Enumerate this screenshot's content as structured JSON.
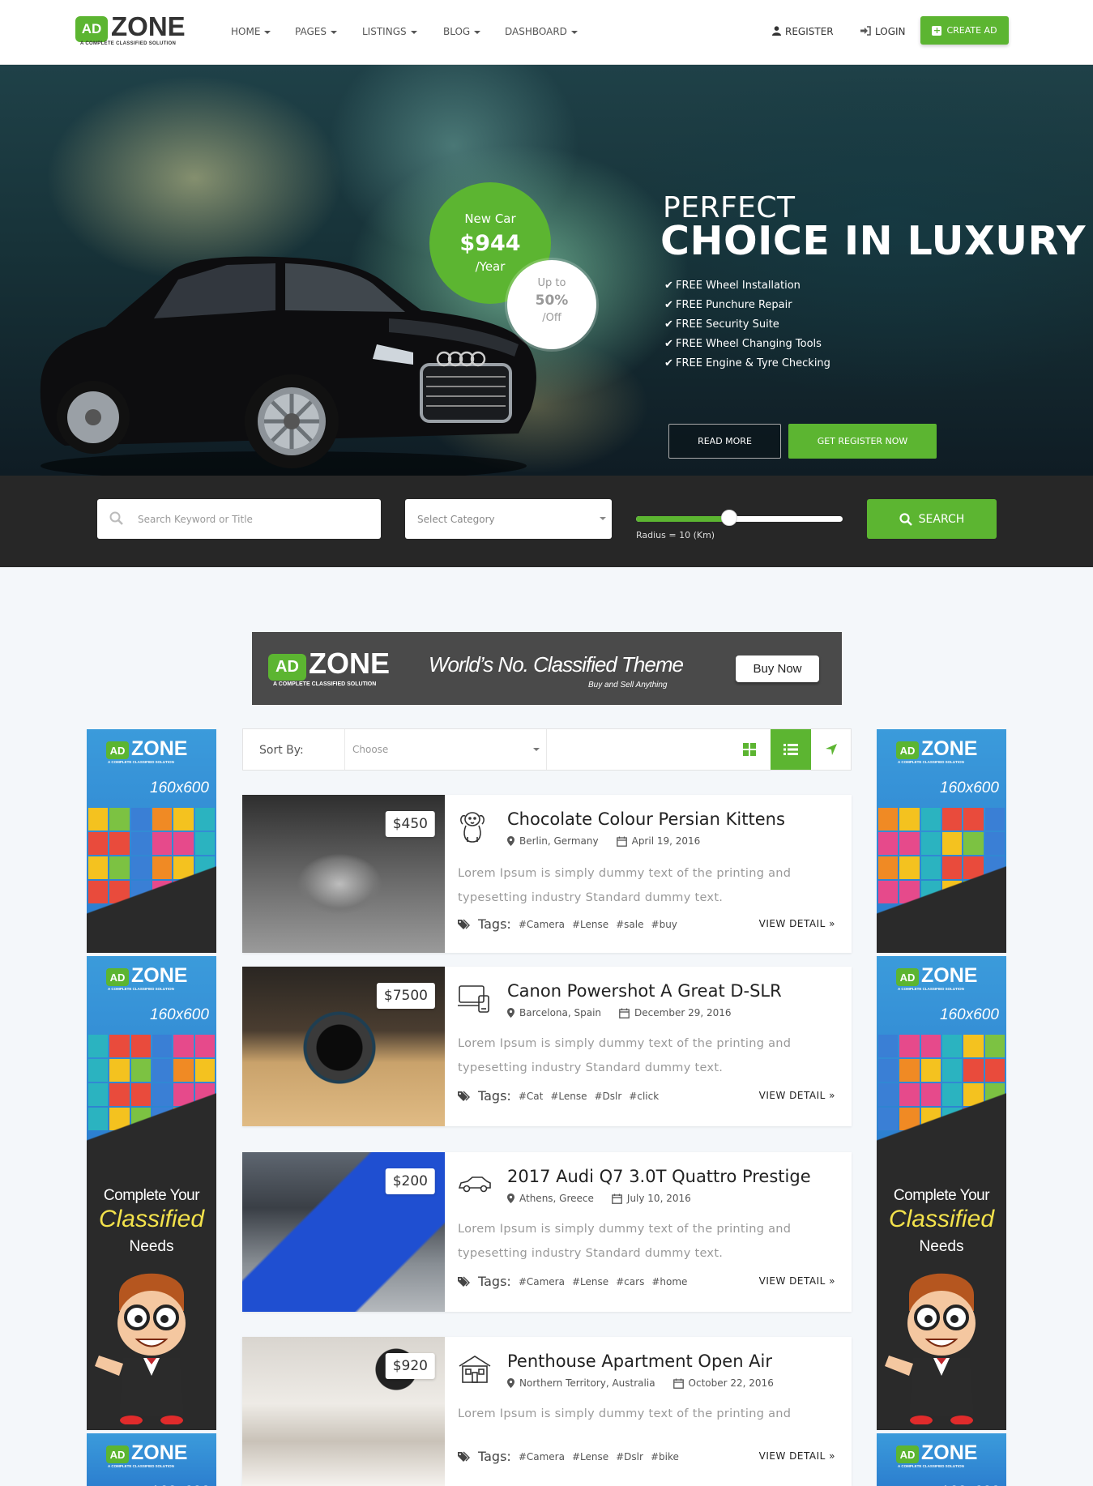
{
  "brand": {
    "ad": "AD",
    "zone": "ZONE",
    "tagline": "A COMPLETE CLASSIFIED SOLUTION"
  },
  "nav": [
    {
      "label": "HOME"
    },
    {
      "label": "PAGES"
    },
    {
      "label": "LISTINGS"
    },
    {
      "label": "BLOG"
    },
    {
      "label": "DASHBOARD"
    }
  ],
  "header": {
    "register": "REGISTER",
    "login": "LOGIN",
    "create_ad": "CREATE AD"
  },
  "hero": {
    "badge_label": "New Car",
    "badge_price": "$944",
    "badge_period": "/Year",
    "discount_prefix": "Up to",
    "discount_value": "50%",
    "discount_suffix": "/Off",
    "heading_line1": "PERFECT",
    "heading_line2": "CHOICE IN LUXURY",
    "features": [
      "FREE Wheel Installation",
      "FREE Punchure Repair",
      "FREE Security Suite",
      "FREE Wheel Changing Tools",
      "FREE Engine & Tyre Checking"
    ],
    "read_more": "READ MORE",
    "register_now": "GET REGISTER NOW"
  },
  "search": {
    "keyword_placeholder": "Search Keyword or Title",
    "category_placeholder": "Select Category",
    "radius_label": "Radius = 10 (Km)",
    "radius_level": 0.45,
    "button": "SEARCH"
  },
  "banner": {
    "ad": "AD",
    "zone": "ZONE",
    "tagline": "A COMPLETE CLASSIFIED SOLUTION",
    "slogan": "World’s No. Classified Theme",
    "sub": "Buy and Sell Anything",
    "button": "Buy Now"
  },
  "side_ad": {
    "ad": "AD",
    "zone": "ZONE",
    "tagline": "A COMPLETE CLASSIFIED SOLUTION",
    "size": "160x600",
    "pitch1": "Complete Your",
    "pitch2": "Classified",
    "pitch3": "Needs"
  },
  "sort": {
    "label": "Sort By:",
    "selected": "Choose"
  },
  "listings": [
    {
      "price": "$450",
      "title": "Chocolate Colour Persian Kittens",
      "location": "Berlin, Germany",
      "date": "April 19, 2016",
      "desc": "Lorem Ipsum is simply dummy text of the printing and typesetting industry Standard dummy text.",
      "tags_label": "Tags:",
      "tags": [
        "#Camera",
        "#Lense",
        "#sale",
        "#buy"
      ],
      "view": "VIEW DETAIL",
      "icon": "dog-icon"
    },
    {
      "price": "$7500",
      "title": "Canon Powershot A Great D-SLR",
      "location": "Barcelona, Spain",
      "date": "December 29, 2016",
      "desc": "Lorem Ipsum is simply dummy text of the printing and typesetting industry Standard dummy text.",
      "tags_label": "Tags:",
      "tags": [
        "#Cat",
        "#Lense",
        "#Dslr",
        "#click"
      ],
      "view": "VIEW DETAIL",
      "icon": "devices-icon"
    },
    {
      "price": "$200",
      "title": "2017 Audi Q7 3.0T Quattro Prestige",
      "location": "Athens, Greece",
      "date": "July 10, 2016",
      "desc": "Lorem Ipsum is simply dummy text of the printing and typesetting industry Standard dummy text.",
      "tags_label": "Tags:",
      "tags": [
        "#Camera",
        "#Lense",
        "#cars",
        "#home"
      ],
      "view": "VIEW DETAIL",
      "icon": "car-icon"
    },
    {
      "price": "$920",
      "title": "Penthouse Apartment Open Air",
      "location": "Northern Territory, Australia",
      "date": "October 22, 2016",
      "desc": "Lorem Ipsum is simply dummy text of the printing and",
      "tags_label": "Tags:",
      "tags": [
        "#Camera",
        "#Lense",
        "#Dslr",
        "#bike"
      ],
      "view": "VIEW DETAIL",
      "icon": "house-icon"
    }
  ],
  "colors": {
    "accent": "#5cb531",
    "dark_bar": "#272727",
    "page_bg": "#f4f7fa"
  }
}
